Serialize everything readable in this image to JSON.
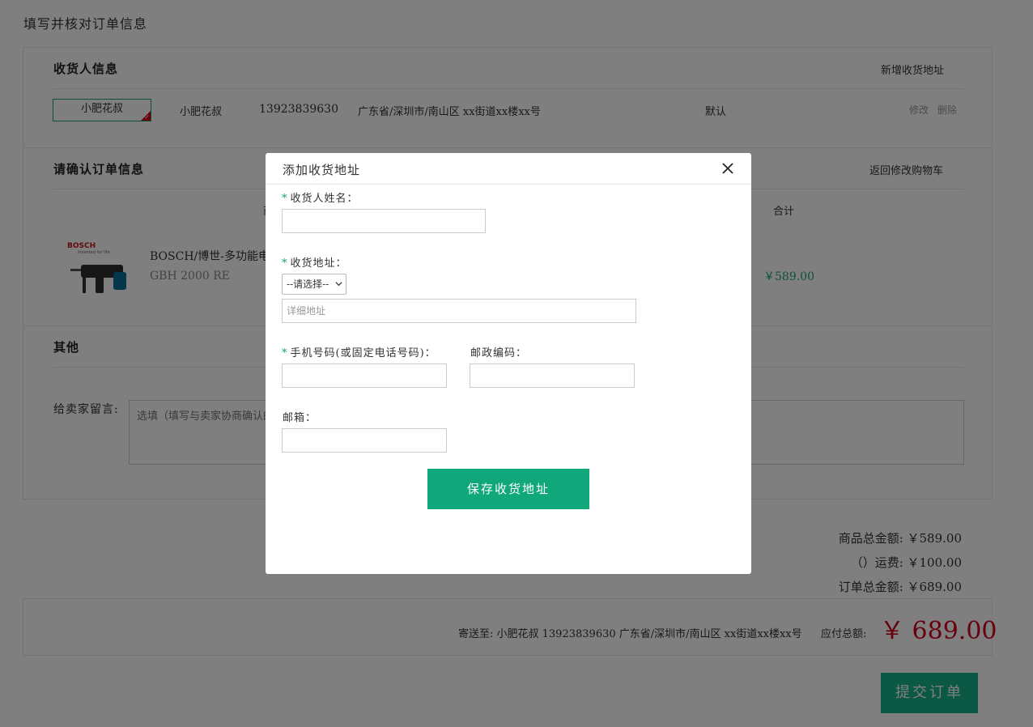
{
  "page": {
    "title": "填写并核对订单信息"
  },
  "consignee": {
    "section_title": "收货人信息",
    "add_link": "新增收货地址",
    "selected_card_label": "小肥花叔",
    "name": "小肥花叔",
    "phone": "13923839630",
    "address": "广东省/深圳市/南山区 xx街道xx楼xx号",
    "default_tag": "默认",
    "edit_label": "修改",
    "delete_label": "删除"
  },
  "order": {
    "section_title": "请确认订单信息",
    "back_link": "返回修改购物车",
    "col_product": "商",
    "col_total": "合计",
    "product": {
      "brand": "BOSCH",
      "brand_tagline": "Invented for life",
      "name": "BOSCH/博世-多功能电锤",
      "model": "GBH 2000 RE",
      "subtotal": "￥589.00"
    }
  },
  "other": {
    "section_title": "其他",
    "message_label": "给卖家留言:",
    "message_placeholder": "选填（填写与卖家协商确认的内容）"
  },
  "summary": {
    "goods_total": "商品总金额: ￥589.00",
    "shipping": "（）运费: ￥100.00",
    "order_total": "订单总金额: ￥689.00"
  },
  "bottom": {
    "ship_to": "寄送至: 小肥花叔 13923839630 广东省/深圳市/南山区 xx街道xx楼xx号",
    "pay_label": "应付总额:",
    "pay_total": "￥ 689.00",
    "submit_label": "提交订单"
  },
  "colors": {
    "accent": "#1a9e77",
    "button": "#10a77b",
    "price_red": "#d0021b"
  },
  "modal": {
    "title": "添加收货地址",
    "close_icon": "close-icon",
    "required_mark": "*",
    "name_label": "收货人姓名：",
    "name_value": "",
    "address_label": "收货地址：",
    "region_select": "--请选择--",
    "detail_placeholder": "详细地址",
    "phone_label": "手机号码(或固定电话号码)：",
    "phone_value": "",
    "zip_label": "邮政编码：",
    "zip_value": "",
    "email_label": "邮箱：",
    "email_value": "",
    "save_label": "保存收货地址"
  }
}
